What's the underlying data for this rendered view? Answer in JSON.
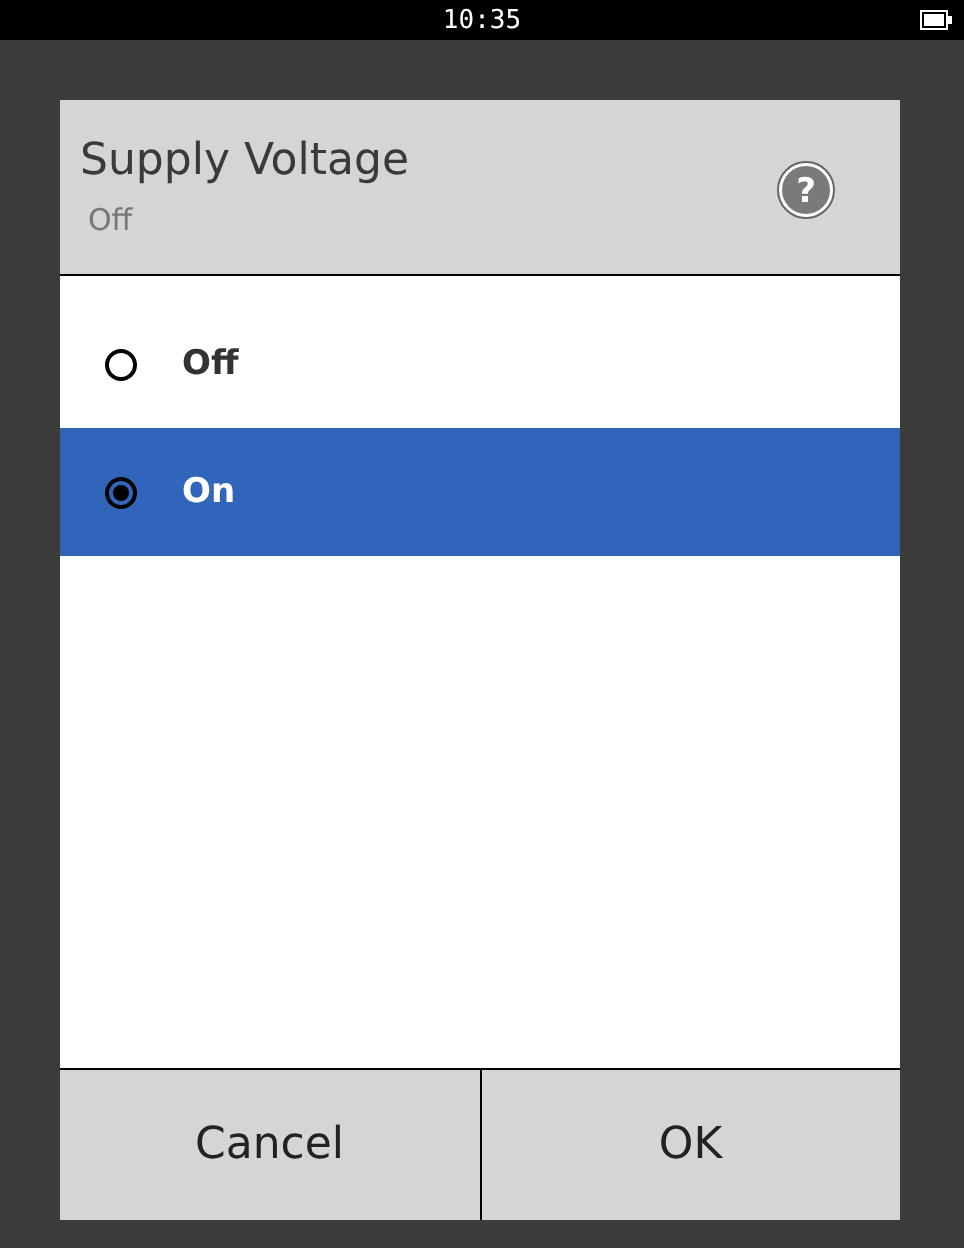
{
  "status_bar": {
    "time": "10:35"
  },
  "dialog": {
    "title": "Supply Voltage",
    "subtitle": "Off",
    "help_glyph": "?",
    "options": [
      {
        "label": "Off",
        "selected": false
      },
      {
        "label": "On",
        "selected": true
      }
    ],
    "buttons": [
      "Cancel",
      "OK"
    ]
  }
}
